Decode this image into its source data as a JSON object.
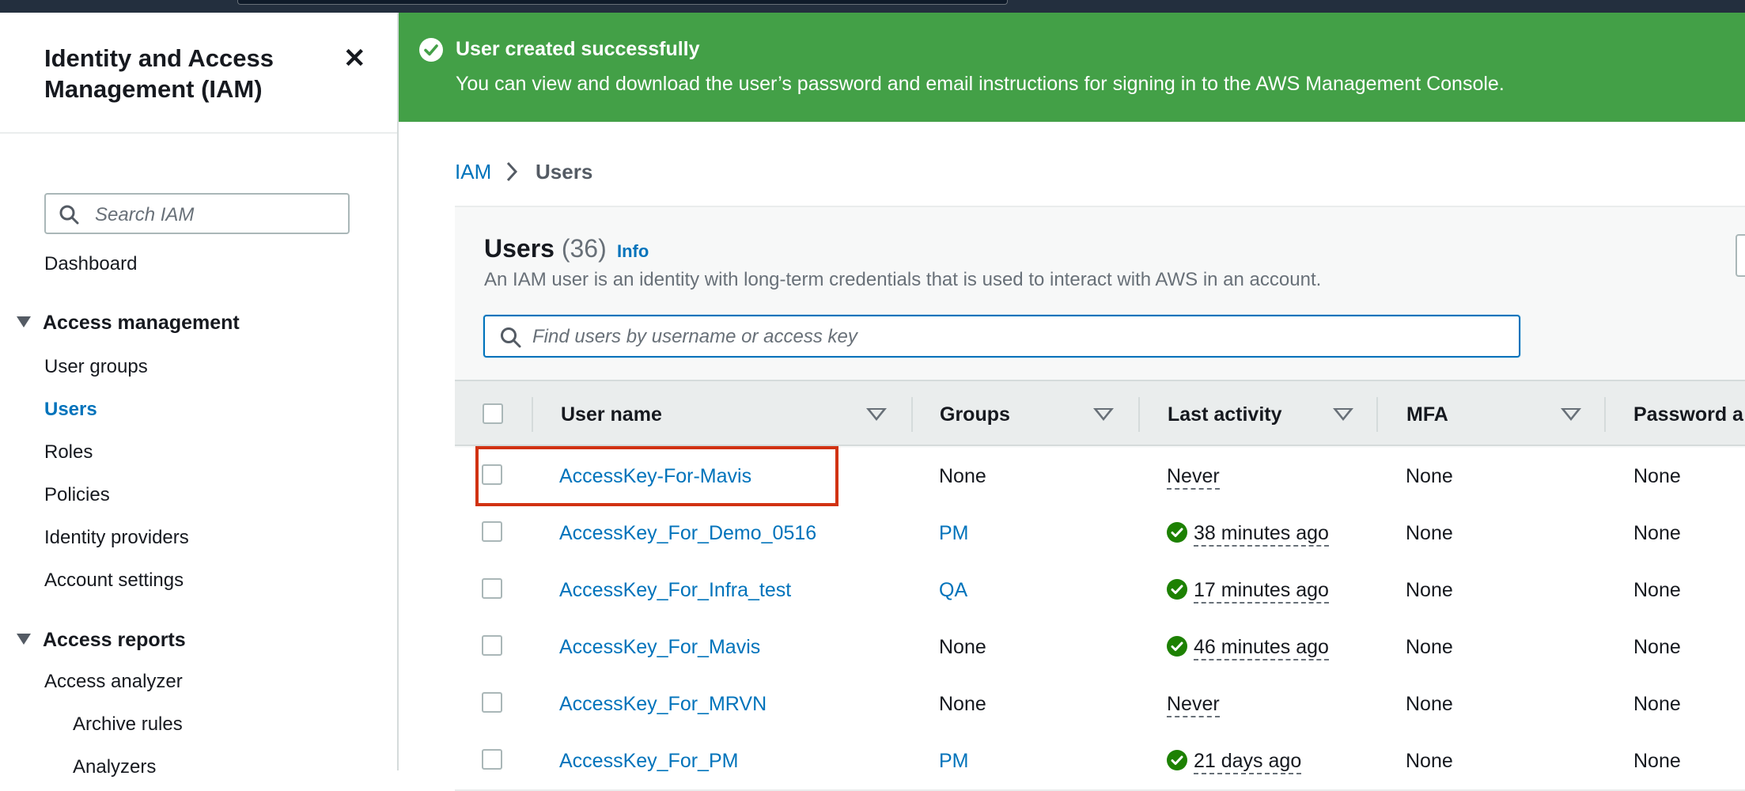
{
  "sidebar": {
    "title": "Identity and Access Management (IAM)",
    "close_icon": "close-icon",
    "search_placeholder": "Search IAM",
    "dashboard": "Dashboard",
    "access_management": {
      "label": "Access management",
      "items": [
        "User groups",
        "Users",
        "Roles",
        "Policies",
        "Identity providers",
        "Account settings"
      ],
      "active": "Users"
    },
    "access_reports": {
      "label": "Access reports",
      "items": [
        "Access analyzer",
        "Archive rules",
        "Analyzers"
      ]
    }
  },
  "banner": {
    "title": "User created successfully",
    "message": "You can view and download the user’s password and email instructions for signing in to the AWS Management Console.",
    "color": "#43a047"
  },
  "breadcrumb": {
    "root": "IAM",
    "current": "Users"
  },
  "users_panel": {
    "title": "Users",
    "count": "(36)",
    "info": "Info",
    "description": "An IAM user is an identity with long-term credentials that is used to interact with AWS in an account.",
    "search_placeholder": "Find users by username or access key"
  },
  "table": {
    "columns": [
      "User name",
      "Groups",
      "Last activity",
      "MFA",
      "Password a"
    ],
    "rows": [
      {
        "name": "AccessKey-For-Mavis",
        "groups": "None",
        "last_activity": "Never",
        "activity_ok": false,
        "mfa": "None",
        "password": "None"
      },
      {
        "name": "AccessKey_For_Demo_0516",
        "groups": "PM",
        "last_activity": "38 minutes ago",
        "activity_ok": true,
        "mfa": "None",
        "password": "None"
      },
      {
        "name": "AccessKey_For_Infra_test",
        "groups": "QA",
        "last_activity": "17 minutes ago",
        "activity_ok": true,
        "mfa": "None",
        "password": "None"
      },
      {
        "name": "AccessKey_For_Mavis",
        "groups": "None",
        "last_activity": "46 minutes ago",
        "activity_ok": true,
        "mfa": "None",
        "password": "None"
      },
      {
        "name": "AccessKey_For_MRVN",
        "groups": "None",
        "last_activity": "Never",
        "activity_ok": false,
        "mfa": "None",
        "password": "None"
      },
      {
        "name": "AccessKey_For_PM",
        "groups": "PM",
        "last_activity": "21 days ago",
        "activity_ok": true,
        "mfa": "None",
        "password": "None"
      }
    ],
    "highlight_color": "#d13212"
  }
}
